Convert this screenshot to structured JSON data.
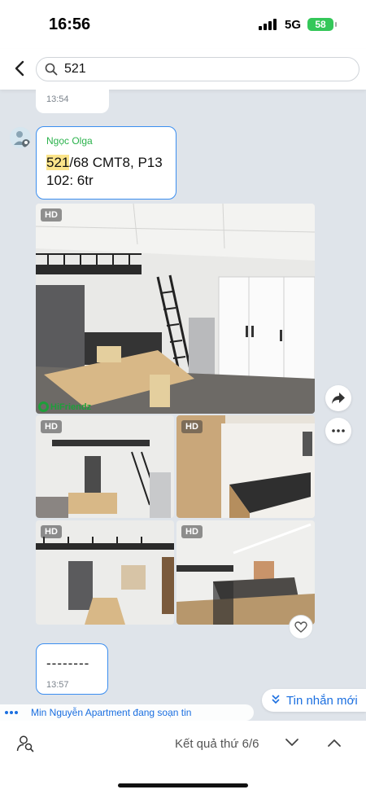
{
  "status": {
    "time": "16:56",
    "network": "5G",
    "battery": "58"
  },
  "search": {
    "query": "521"
  },
  "messages": {
    "prev_time": "13:54",
    "sender": "Ngọc Olga",
    "text_highlight": "521",
    "text_line1_rest": "/68 CMT8, P13",
    "text_line2": "102: 6tr",
    "photo_badge": "HD",
    "watermark": "HiFriendz",
    "dash_text": "--------",
    "dash_time": "13:57"
  },
  "new_messages_label": "Tin nhắn mới",
  "typing_text": "Min Nguyễn Apartment đang soạn tin",
  "bottom": {
    "result_text": "Kết quả thứ 6/6"
  },
  "icons": [
    "back-icon",
    "search-icon",
    "share-icon",
    "more-icon",
    "heart-icon",
    "member-search-icon",
    "chevron-down-icon",
    "chevron-up-icon"
  ],
  "colors": {
    "accent": "#3b8ef0",
    "sender": "#2bb24c",
    "highlight": "#fbe48a",
    "link": "#1b6fe0",
    "battery": "#34c759"
  }
}
